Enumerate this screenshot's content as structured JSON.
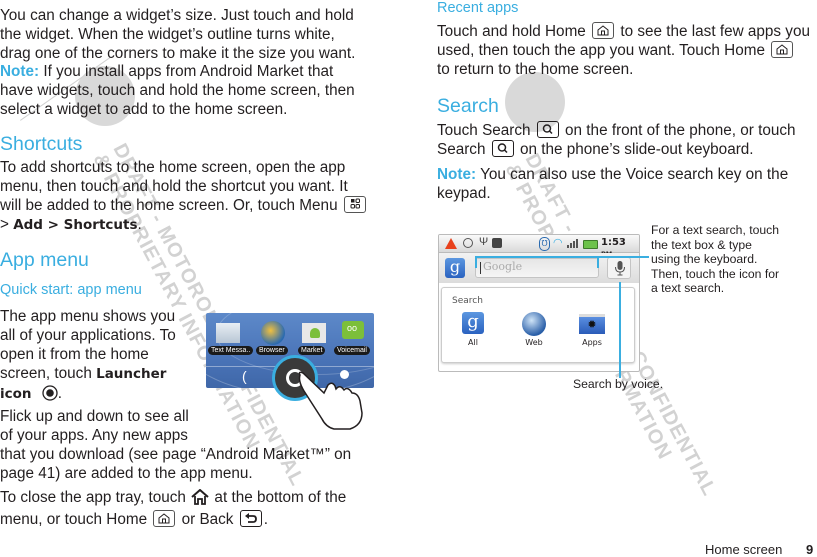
{
  "left": {
    "para1": "You can change a widget’s size. Just touch and hold the widget. When the widget’s outline turns white, drag one of the corners to make it the size you want.",
    "para1_lines": [
      "You can change a widget’s size. Just touch and hold",
      "the widget. When the widget’s outline turns white,",
      "drag one of the corners to make it the size you want."
    ],
    "note_label": "Note:",
    "note_lines": [
      " If you install apps from Android Market that",
      "have widgets, touch and hold the home screen, then",
      "select a widget to add to the home screen."
    ],
    "shortcuts_heading": "Shortcuts",
    "shortcuts_lines": [
      "To add shortcuts to the home screen, open the app",
      "menu, then touch and hold the shortcut you want. It",
      "will be added to the home screen. Or, touch Menu"
    ],
    "shortcuts_path_prefix": "> ",
    "shortcuts_path": "Add > Shortcuts",
    "shortcuts_end": ".",
    "appmenu_heading": "App menu",
    "quickstart_heading": "Quick start: app menu",
    "appmenu_lines": [
      "The app menu shows you",
      "all of your applications. To",
      "open it from the home",
      "screen, touch "
    ],
    "launcher_bold1": "Launcher",
    "launcher_bold2": "icon",
    "flick_lines": [
      "Flick up and down to see all",
      "of your apps. Any new apps",
      "that you download (see page “Android Market™” on",
      "page 41) are added to the app menu."
    ],
    "close_line1_a": "To close the app tray, touch ",
    "close_line1_b": " at the bottom of the",
    "close_line2_a": "menu, or touch Home ",
    "close_line2_b": " or Back ",
    "close_line2_c": ".",
    "phone_apps": [
      {
        "label": "Text Messa.."
      },
      {
        "label": "Browser"
      },
      {
        "label": "Market"
      },
      {
        "label": "Voicemail"
      }
    ]
  },
  "right": {
    "recent_heading": "Recent apps",
    "recent_line1_a": "Touch and hold Home ",
    "recent_line1_b": " to see the last few apps you",
    "recent_line2_a": "used, then touch the app you want. Touch Home ",
    "recent_line3": "to return to the home screen.",
    "search_heading": "Search",
    "search_line1_a": "Touch Search ",
    "search_line1_b": " on the front of the phone, or touch",
    "search_line2_a": "Search ",
    "search_line2_b": " on the phone’s slide-out keyboard.",
    "note_label": "Note:",
    "note_line1": " You can also use the Voice search key on the",
    "note_line2": "keypad.",
    "phone": {
      "time": "1:53",
      "ampm": "PM",
      "search_placeholder": "Google",
      "section_label": "Search",
      "options": [
        {
          "label": "All"
        },
        {
          "label": "Web"
        },
        {
          "label": "Apps"
        }
      ]
    },
    "callout_text_lines": [
      "For a text search, touch",
      "the text box & type",
      "using the keyboard.",
      "Then, touch the icon for",
      "a text search."
    ],
    "callout_voice": "Search by voice."
  },
  "footer": {
    "section": "Home screen",
    "page": "9"
  },
  "watermark": {
    "line1": "DRAFT - MOTOROLA CONFIDENTIAL",
    "line2": "& PROPRIETARY INFORMATION"
  },
  "colors": {
    "accent": "#3aaee0",
    "text": "#231f20",
    "watermark": "#d2d2d2"
  }
}
